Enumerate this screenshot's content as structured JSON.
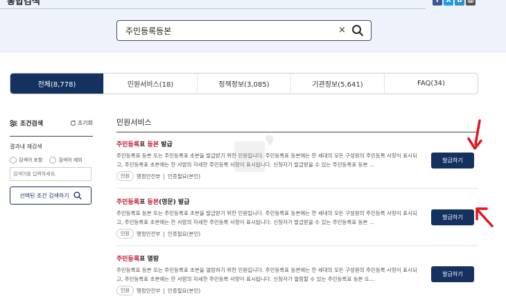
{
  "header": {
    "title": "통합검색",
    "share_icons": [
      {
        "label": "f",
        "color": "#3b5998"
      },
      {
        "label": "X",
        "color": "#1d9bf0"
      },
      {
        "label": "b",
        "color": "#2b8fd6"
      },
      {
        "label": "⎙",
        "color": "#555555"
      }
    ]
  },
  "search": {
    "value": "주민등록등본",
    "clear": "×"
  },
  "tabs": [
    {
      "label": "전체(8,778)",
      "active": true
    },
    {
      "label": "민원서비스(18)",
      "active": false
    },
    {
      "label": "정책정보(3,085)",
      "active": false
    },
    {
      "label": "기관정보(5,641)",
      "active": false
    },
    {
      "label": "FAQ(34)",
      "active": false
    }
  ],
  "sidebar": {
    "title": "조건검색",
    "reset": "초기화",
    "sub_title": "결과내 재검색",
    "radio_include": "검색어 포함",
    "radio_exclude": "검색어 제외",
    "input_placeholder": "검색어를 입력하세요.",
    "search_button": "선택된 조건 검색하기"
  },
  "results": {
    "section_title": "민원서비스",
    "items": [
      {
        "title_hl": "주민등록",
        "title_mid": "표 ",
        "title_hl2": "등본",
        "title_rest": " 발급",
        "desc": "주민등록표 등본 또는 주민등록표 초본을 발급받기 위한 민원입니다. 주민등록표 등본에는 한 세대의 모든 구성원의 주민등록 사항이 표시되고, 주민등록표 초본에는 한 사람의 자세한 주민등록 사항이 표시됩니다. 신청자가 발급받을 수 있는 주민등록표 등본 …",
        "badge": "인원",
        "agency": "행정안전부",
        "auth": "인증필요(본인)",
        "button": "발급하기"
      },
      {
        "title_hl": "주민등록",
        "title_mid": "표 ",
        "title_hl2": "등본",
        "title_rest": "(영문) 발급",
        "desc": "주민등록표 등본 또는 주민등록표 초본을 발급받기 위한 민원입니다. 주민등록표 등본에는 한 세대의 모든 구성원의 주민등록 사항이 표시되고, 주민등록표 초본에는 한 사람의 자세한 주민등록 사항이 표시됩니다. 신청자가 발급받을 수 있는 주민등록표 등본 …",
        "badge": "인원",
        "agency": "행정안전부",
        "auth": "인증필요(본인)",
        "button": "발급하기"
      },
      {
        "title_hl": "주민등록",
        "title_mid": "표 열람",
        "title_hl2": "",
        "title_rest": "",
        "desc": "주민등록표 등본 또는 주민등록표 초본을 열람하기 위한 민원입니다. 주민등록표 등본에는 한 세대의 모든 구성원의 주민등록 사항이 표시되고, 주민등록표 초본에는 한 사람의 자세한 주민등록 사항이 표시됩니다. 신청자가 열람할 수 있는 주민등록표 등본 또…",
        "badge": "인원",
        "agency": "행정안전부",
        "auth": "인증필요(본인)",
        "button": "발급하기"
      }
    ]
  },
  "annotation_color": "#e0141e"
}
